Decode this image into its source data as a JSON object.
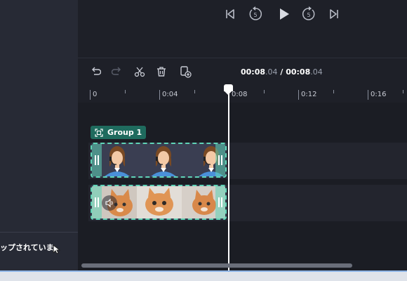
{
  "player": {
    "controls": [
      "skip-to-start",
      "rewind-5",
      "play",
      "forward-5",
      "skip-to-end"
    ],
    "rewind_seconds": "5",
    "forward_seconds": "5"
  },
  "toolbar": {
    "tools": [
      "undo",
      "redo",
      "split",
      "delete",
      "duplicate"
    ],
    "time_current_main": "00:08",
    "time_current_frac": ".04",
    "time_separator": " / ",
    "time_total_main": "00:08",
    "time_total_frac": ".04"
  },
  "ruler": {
    "labels": [
      "0",
      "0:04",
      "0:08",
      "0:12",
      "0:16"
    ]
  },
  "timeline": {
    "group_label": "Group 1",
    "tracks": [
      {
        "name": "character-track",
        "clip_type": "image"
      },
      {
        "name": "cat-video-track",
        "clip_type": "video",
        "has_audio": true
      }
    ]
  },
  "sidebar": {
    "toast_text": "ップされていま"
  },
  "colors": {
    "accent": "#5fd3b6",
    "group_tag": "#1f6b5e",
    "background": "#1e2028",
    "panel": "#272a35"
  }
}
